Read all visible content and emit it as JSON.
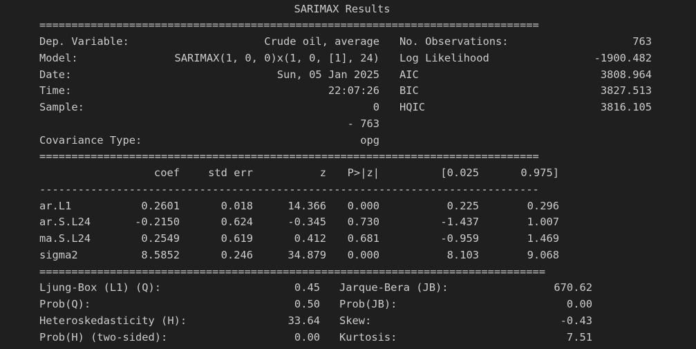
{
  "title": "SARIMAX Results",
  "separators": {
    "double_1": "==============================================================================",
    "double_2": "==============================================================================",
    "double_3": "==============================================================================",
    "single_1": "------------------------------------------------------------------------------",
    "double_4": "==============================================================================="
  },
  "summary": {
    "rows": [
      {
        "l1": "Dep. Variable:",
        "v1": "Crude oil, average",
        "l2": "No. Observations:",
        "v2": "763"
      },
      {
        "l1": "Model:",
        "v1": "SARIMAX(1, 0, 0)x(1, 0, [1], 24)",
        "l2": "Log Likelihood",
        "v2": "-1900.482"
      },
      {
        "l1": "Date:",
        "v1": "Sun, 05 Jan 2025",
        "l2": "AIC",
        "v2": "3808.964"
      },
      {
        "l1": "Time:",
        "v1": "22:07:26",
        "l2": "BIC",
        "v2": "3827.513"
      },
      {
        "l1": "Sample:",
        "v1": "0",
        "l2": "HQIC",
        "v2": "3816.105"
      },
      {
        "l1": "",
        "v1": "- 763",
        "l2": "",
        "v2": ""
      },
      {
        "l1": "Covariance Type:",
        "v1": "opg",
        "l2": "",
        "v2": ""
      }
    ]
  },
  "coef_table": {
    "headers": [
      "",
      "coef",
      "std err",
      "z",
      "P>|z|",
      "[0.025",
      "0.975]"
    ],
    "rows": [
      [
        "ar.L1",
        "0.2601",
        "0.018",
        "14.366",
        "0.000",
        "0.225",
        "0.296"
      ],
      [
        "ar.S.L24",
        "-0.2150",
        "0.624",
        "-0.345",
        "0.730",
        "-1.437",
        "1.007"
      ],
      [
        "ma.S.L24",
        "0.2549",
        "0.619",
        "0.412",
        "0.681",
        "-0.959",
        "1.469"
      ],
      [
        "sigma2",
        "8.5852",
        "0.246",
        "34.879",
        "0.000",
        "8.103",
        "9.068"
      ]
    ]
  },
  "diagnostics": {
    "rows": [
      {
        "l1": "Ljung-Box (L1) (Q):",
        "v1": "0.45",
        "l2": "Jarque-Bera (JB):",
        "v2": "670.62"
      },
      {
        "l1": "Prob(Q):",
        "v1": "0.50",
        "l2": "Prob(JB):",
        "v2": "0.00"
      },
      {
        "l1": "Heteroskedasticity (H):",
        "v1": "33.64",
        "l2": "Skew:",
        "v2": "-0.43"
      },
      {
        "l1": "Prob(H) (two-sided):",
        "v1": "0.00",
        "l2": "Kurtosis:",
        "v2": "7.51"
      }
    ]
  }
}
